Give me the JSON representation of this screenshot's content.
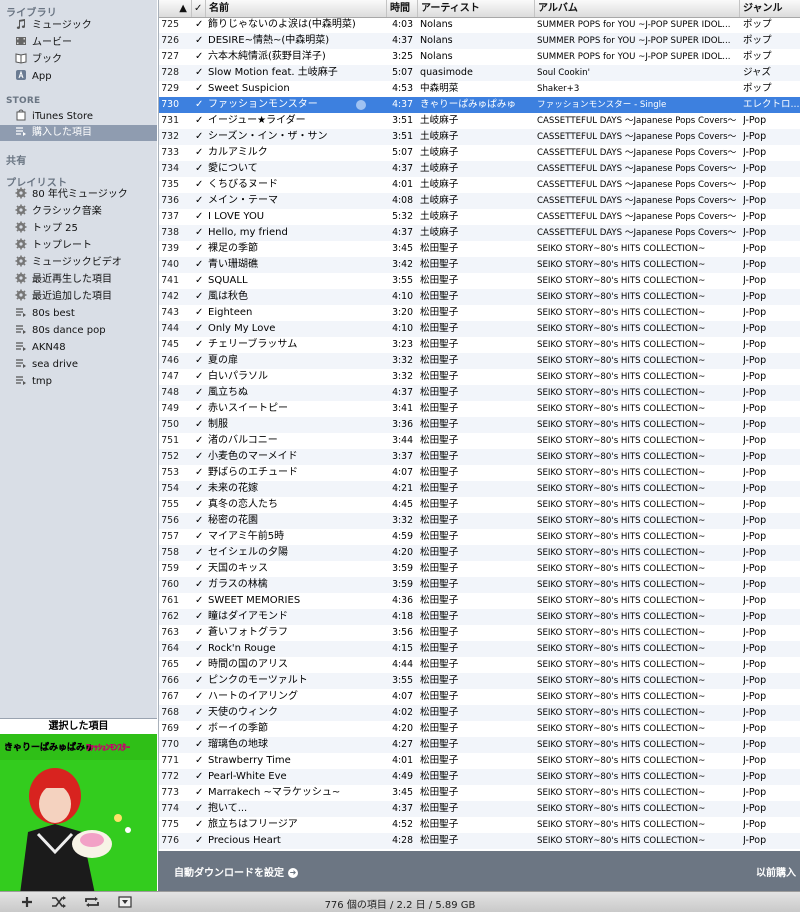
{
  "sidebar": {
    "library_header": "ライブラリ",
    "library_items": [
      {
        "label": "ミュージック",
        "icon": "music-note-icon"
      },
      {
        "label": "ムービー",
        "icon": "film-icon"
      },
      {
        "label": "ブック",
        "icon": "book-icon"
      },
      {
        "label": "App",
        "icon": "app-icon"
      }
    ],
    "store_header": "STORE",
    "store_items": [
      {
        "label": "iTunes Store",
        "icon": "store-icon"
      },
      {
        "label": "購入した項目",
        "icon": "purchased-icon"
      }
    ],
    "shared_header": "共有",
    "playlists_header": "プレイリスト",
    "smart_playlists": [
      {
        "label": "80 年代ミュージック"
      },
      {
        "label": "クラシック音楽"
      },
      {
        "label": "トップ 25"
      },
      {
        "label": "トップレート"
      },
      {
        "label": "ミュージックビデオ"
      },
      {
        "label": "最近再生した項目"
      },
      {
        "label": "最近追加した項目"
      }
    ],
    "playlists": [
      {
        "label": "80s best"
      },
      {
        "label": "80s dance pop"
      },
      {
        "label": "AKN48"
      },
      {
        "label": "sea drive"
      },
      {
        "label": "tmp"
      }
    ]
  },
  "artwork": {
    "caption": "選択した項目",
    "cover_title": "きゃりーぱみゅぱみゅ ファッションモンスター"
  },
  "table": {
    "columns": {
      "name": "名前",
      "time": "時間",
      "artist": "アーティスト",
      "album": "アルバム",
      "genre": "ジャンル"
    },
    "check_mark": "✓",
    "selected_index": 730,
    "rows": [
      {
        "n": "725",
        "name": "飾りじゃないのよ涙は(中森明菜)",
        "time": "4:03",
        "artist": "Nolans",
        "album": "SUMMER POPS for YOU ~J-POP SUPER IDOL...",
        "genre": "ポップ"
      },
      {
        "n": "726",
        "name": "DESIRE~情熱~(中森明菜)",
        "time": "4:37",
        "artist": "Nolans",
        "album": "SUMMER POPS for YOU ~J-POP SUPER IDOL...",
        "genre": "ポップ"
      },
      {
        "n": "727",
        "name": "六本木純情派(荻野目洋子)",
        "time": "3:25",
        "artist": "Nolans",
        "album": "SUMMER POPS for YOU ~J-POP SUPER IDOL...",
        "genre": "ポップ"
      },
      {
        "n": "728",
        "name": "Slow Motion feat. 土岐麻子",
        "time": "5:07",
        "artist": "quasimode",
        "album": "Soul Cookin'",
        "genre": "ジャズ"
      },
      {
        "n": "729",
        "name": "Sweet Suspicion",
        "time": "4:53",
        "artist": "中森明菜",
        "album": "Shaker+3",
        "genre": "ポップ"
      },
      {
        "n": "730",
        "name": "ファッションモンスター",
        "time": "4:37",
        "artist": "きゃりーぱみゅぱみゅ",
        "album": "ファッションモンスター - Single",
        "genre": "エレクトロ..."
      },
      {
        "n": "731",
        "name": "イージュー★ライダー",
        "time": "3:51",
        "artist": "土岐麻子",
        "album": "CASSETTEFUL DAYS ～Japanese Pops Covers～",
        "genre": "J-Pop"
      },
      {
        "n": "732",
        "name": "シーズン・イン・ザ・サン",
        "time": "3:51",
        "artist": "土岐麻子",
        "album": "CASSETTEFUL DAYS ～Japanese Pops Covers～",
        "genre": "J-Pop"
      },
      {
        "n": "733",
        "name": "カルアミルク",
        "time": "5:07",
        "artist": "土岐麻子",
        "album": "CASSETTEFUL DAYS ～Japanese Pops Covers～",
        "genre": "J-Pop"
      },
      {
        "n": "734",
        "name": "愛について",
        "time": "4:37",
        "artist": "土岐麻子",
        "album": "CASSETTEFUL DAYS ～Japanese Pops Covers～",
        "genre": "J-Pop"
      },
      {
        "n": "735",
        "name": "くちびるヌード",
        "time": "4:01",
        "artist": "土岐麻子",
        "album": "CASSETTEFUL DAYS ～Japanese Pops Covers～",
        "genre": "J-Pop"
      },
      {
        "n": "736",
        "name": "メイン・テーマ",
        "time": "4:08",
        "artist": "土岐麻子",
        "album": "CASSETTEFUL DAYS ～Japanese Pops Covers～",
        "genre": "J-Pop"
      },
      {
        "n": "737",
        "name": "I LOVE YOU",
        "time": "5:32",
        "artist": "土岐麻子",
        "album": "CASSETTEFUL DAYS ～Japanese Pops Covers～",
        "genre": "J-Pop"
      },
      {
        "n": "738",
        "name": "Hello, my friend",
        "time": "4:37",
        "artist": "土岐麻子",
        "album": "CASSETTEFUL DAYS ～Japanese Pops Covers～",
        "genre": "J-Pop"
      },
      {
        "n": "739",
        "name": "裸足の季節",
        "time": "3:45",
        "artist": "松田聖子",
        "album": "SEIKO STORY~80's HITS COLLECTION~",
        "genre": "J-Pop"
      },
      {
        "n": "740",
        "name": "青い珊瑚礁",
        "time": "3:42",
        "artist": "松田聖子",
        "album": "SEIKO STORY~80's HITS COLLECTION~",
        "genre": "J-Pop"
      },
      {
        "n": "741",
        "name": "SQUALL",
        "time": "3:55",
        "artist": "松田聖子",
        "album": "SEIKO STORY~80's HITS COLLECTION~",
        "genre": "J-Pop"
      },
      {
        "n": "742",
        "name": "風は秋色",
        "time": "4:10",
        "artist": "松田聖子",
        "album": "SEIKO STORY~80's HITS COLLECTION~",
        "genre": "J-Pop"
      },
      {
        "n": "743",
        "name": "Eighteen",
        "time": "3:20",
        "artist": "松田聖子",
        "album": "SEIKO STORY~80's HITS COLLECTION~",
        "genre": "J-Pop"
      },
      {
        "n": "744",
        "name": "Only My Love",
        "time": "4:10",
        "artist": "松田聖子",
        "album": "SEIKO STORY~80's HITS COLLECTION~",
        "genre": "J-Pop"
      },
      {
        "n": "745",
        "name": "チェリーブラッサム",
        "time": "3:23",
        "artist": "松田聖子",
        "album": "SEIKO STORY~80's HITS COLLECTION~",
        "genre": "J-Pop"
      },
      {
        "n": "746",
        "name": "夏の扉",
        "time": "3:32",
        "artist": "松田聖子",
        "album": "SEIKO STORY~80's HITS COLLECTION~",
        "genre": "J-Pop"
      },
      {
        "n": "747",
        "name": "白いパラソル",
        "time": "3:32",
        "artist": "松田聖子",
        "album": "SEIKO STORY~80's HITS COLLECTION~",
        "genre": "J-Pop"
      },
      {
        "n": "748",
        "name": "風立ちぬ",
        "time": "4:37",
        "artist": "松田聖子",
        "album": "SEIKO STORY~80's HITS COLLECTION~",
        "genre": "J-Pop"
      },
      {
        "n": "749",
        "name": "赤いスイートピー",
        "time": "3:41",
        "artist": "松田聖子",
        "album": "SEIKO STORY~80's HITS COLLECTION~",
        "genre": "J-Pop"
      },
      {
        "n": "750",
        "name": "制服",
        "time": "3:36",
        "artist": "松田聖子",
        "album": "SEIKO STORY~80's HITS COLLECTION~",
        "genre": "J-Pop"
      },
      {
        "n": "751",
        "name": "渚のバルコニー",
        "time": "3:44",
        "artist": "松田聖子",
        "album": "SEIKO STORY~80's HITS COLLECTION~",
        "genre": "J-Pop"
      },
      {
        "n": "752",
        "name": "小麦色のマーメイド",
        "time": "3:37",
        "artist": "松田聖子",
        "album": "SEIKO STORY~80's HITS COLLECTION~",
        "genre": "J-Pop"
      },
      {
        "n": "753",
        "name": "野ばらのエチュード",
        "time": "4:07",
        "artist": "松田聖子",
        "album": "SEIKO STORY~80's HITS COLLECTION~",
        "genre": "J-Pop"
      },
      {
        "n": "754",
        "name": "未来の花嫁",
        "time": "4:21",
        "artist": "松田聖子",
        "album": "SEIKO STORY~80's HITS COLLECTION~",
        "genre": "J-Pop"
      },
      {
        "n": "755",
        "name": "真冬の恋人たち",
        "time": "4:45",
        "artist": "松田聖子",
        "album": "SEIKO STORY~80's HITS COLLECTION~",
        "genre": "J-Pop"
      },
      {
        "n": "756",
        "name": "秘密の花園",
        "time": "3:32",
        "artist": "松田聖子",
        "album": "SEIKO STORY~80's HITS COLLECTION~",
        "genre": "J-Pop"
      },
      {
        "n": "757",
        "name": "マイアミ午前5時",
        "time": "4:59",
        "artist": "松田聖子",
        "album": "SEIKO STORY~80's HITS COLLECTION~",
        "genre": "J-Pop"
      },
      {
        "n": "758",
        "name": "セイシェルの夕陽",
        "time": "4:20",
        "artist": "松田聖子",
        "album": "SEIKO STORY~80's HITS COLLECTION~",
        "genre": "J-Pop"
      },
      {
        "n": "759",
        "name": "天国のキッス",
        "time": "3:59",
        "artist": "松田聖子",
        "album": "SEIKO STORY~80's HITS COLLECTION~",
        "genre": "J-Pop"
      },
      {
        "n": "760",
        "name": "ガラスの林檎",
        "time": "3:59",
        "artist": "松田聖子",
        "album": "SEIKO STORY~80's HITS COLLECTION~",
        "genre": "J-Pop"
      },
      {
        "n": "761",
        "name": "SWEET MEMORIES",
        "time": "4:36",
        "artist": "松田聖子",
        "album": "SEIKO STORY~80's HITS COLLECTION~",
        "genre": "J-Pop"
      },
      {
        "n": "762",
        "name": "瞳はダイアモンド",
        "time": "4:18",
        "artist": "松田聖子",
        "album": "SEIKO STORY~80's HITS COLLECTION~",
        "genre": "J-Pop"
      },
      {
        "n": "763",
        "name": "蒼いフォトグラフ",
        "time": "3:56",
        "artist": "松田聖子",
        "album": "SEIKO STORY~80's HITS COLLECTION~",
        "genre": "J-Pop"
      },
      {
        "n": "764",
        "name": "Rock'n Rouge",
        "time": "4:15",
        "artist": "松田聖子",
        "album": "SEIKO STORY~80's HITS COLLECTION~",
        "genre": "J-Pop"
      },
      {
        "n": "765",
        "name": "時間の国のアリス",
        "time": "4:44",
        "artist": "松田聖子",
        "album": "SEIKO STORY~80's HITS COLLECTION~",
        "genre": "J-Pop"
      },
      {
        "n": "766",
        "name": "ピンクのモーツァルト",
        "time": "3:55",
        "artist": "松田聖子",
        "album": "SEIKO STORY~80's HITS COLLECTION~",
        "genre": "J-Pop"
      },
      {
        "n": "767",
        "name": "ハートのイアリング",
        "time": "4:07",
        "artist": "松田聖子",
        "album": "SEIKO STORY~80's HITS COLLECTION~",
        "genre": "J-Pop"
      },
      {
        "n": "768",
        "name": "天使のウィンク",
        "time": "4:02",
        "artist": "松田聖子",
        "album": "SEIKO STORY~80's HITS COLLECTION~",
        "genre": "J-Pop"
      },
      {
        "n": "769",
        "name": "ボーイの季節",
        "time": "4:20",
        "artist": "松田聖子",
        "album": "SEIKO STORY~80's HITS COLLECTION~",
        "genre": "J-Pop"
      },
      {
        "n": "770",
        "name": "瑠璃色の地球",
        "time": "4:27",
        "artist": "松田聖子",
        "album": "SEIKO STORY~80's HITS COLLECTION~",
        "genre": "J-Pop"
      },
      {
        "n": "771",
        "name": "Strawberry Time",
        "time": "4:01",
        "artist": "松田聖子",
        "album": "SEIKO STORY~80's HITS COLLECTION~",
        "genre": "J-Pop"
      },
      {
        "n": "772",
        "name": "Pearl-White Eve",
        "time": "4:49",
        "artist": "松田聖子",
        "album": "SEIKO STORY~80's HITS COLLECTION~",
        "genre": "J-Pop"
      },
      {
        "n": "773",
        "name": "Marrakech ~マラケッシュ~",
        "time": "3:45",
        "artist": "松田聖子",
        "album": "SEIKO STORY~80's HITS COLLECTION~",
        "genre": "J-Pop"
      },
      {
        "n": "774",
        "name": "抱いて...",
        "time": "4:37",
        "artist": "松田聖子",
        "album": "SEIKO STORY~80's HITS COLLECTION~",
        "genre": "J-Pop"
      },
      {
        "n": "775",
        "name": "旅立ちはフリージア",
        "time": "4:52",
        "artist": "松田聖子",
        "album": "SEIKO STORY~80's HITS COLLECTION~",
        "genre": "J-Pop"
      },
      {
        "n": "776",
        "name": "Precious Heart",
        "time": "4:28",
        "artist": "松田聖子",
        "album": "SEIKO STORY~80's HITS COLLECTION~",
        "genre": "J-Pop"
      }
    ]
  },
  "autobar": {
    "auto_download_label": "自動ダウンロードを設定",
    "previous_purchase_label": "以前購入"
  },
  "statusbar": {
    "summary": "776 個の項目 / 2.2 日 / 5.89 GB"
  },
  "colors": {
    "sidebar_bg": "#d9dee6",
    "selection_blue": "#3d80df",
    "sidebar_selected": "#8f9cb0",
    "footer_bar": "#6c7683",
    "artwork_green": "#2ecc1a"
  }
}
